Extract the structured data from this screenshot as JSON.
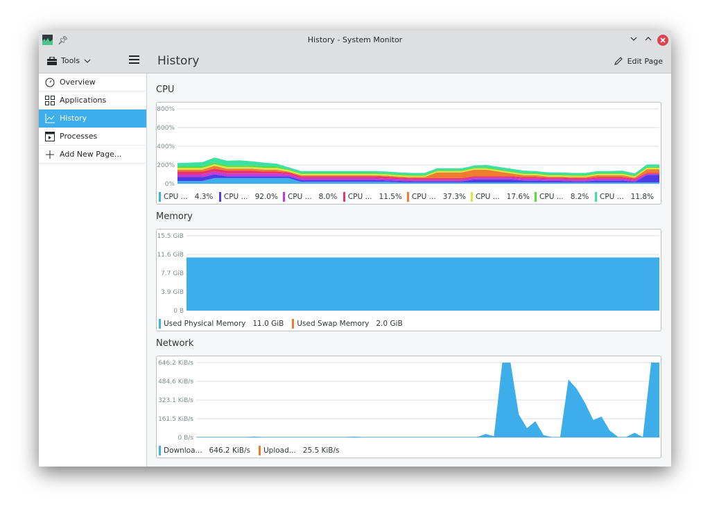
{
  "window": {
    "title": "History - System Monitor",
    "buttons": {
      "minimize": "﹀",
      "maximize": "︿",
      "close": "✕"
    }
  },
  "header": {
    "tools_label": "Tools",
    "page_title": "History",
    "edit_page_label": "Edit Page"
  },
  "sidebar": {
    "items": [
      {
        "label": "Overview",
        "icon": "gauge-icon",
        "active": false
      },
      {
        "label": "Applications",
        "icon": "grid-icon",
        "active": false
      },
      {
        "label": "History",
        "icon": "chart-line-icon",
        "active": true
      },
      {
        "label": "Processes",
        "icon": "terminal-window-icon",
        "active": false
      },
      {
        "label": "Add New Page...",
        "icon": "plus-icon",
        "active": false
      }
    ]
  },
  "colors": {
    "accent": "#3daee9",
    "close": "#da4453"
  },
  "sections": {
    "cpu": {
      "title": "CPU"
    },
    "memory": {
      "title": "Memory"
    },
    "network": {
      "title": "Network"
    }
  },
  "chart_data": [
    {
      "type": "area",
      "title": "CPU",
      "stacked": true,
      "y_ticks": [
        "800%",
        "600%",
        "400%",
        "200%",
        "0%"
      ],
      "ylim": [
        0,
        800
      ],
      "grid": true,
      "legend_placement": "bottom",
      "x_points": 40,
      "series": [
        {
          "name": "CPU ...",
          "value_label": "4.3%",
          "color": "#3daee9",
          "values": [
            30,
            30,
            30,
            60,
            60,
            60,
            60,
            60,
            60,
            60,
            20,
            20,
            20,
            20,
            20,
            20,
            20,
            20,
            15,
            15,
            15,
            15,
            15,
            15,
            15,
            15,
            15,
            15,
            15,
            15,
            15,
            15,
            15,
            15,
            15,
            15,
            15,
            15,
            15,
            15
          ]
        },
        {
          "name": "CPU ...",
          "value_label": "92.0%",
          "color": "#4f3ce6",
          "values": [
            40,
            40,
            40,
            40,
            20,
            20,
            20,
            20,
            20,
            20,
            20,
            20,
            20,
            20,
            20,
            20,
            20,
            15,
            15,
            10,
            10,
            10,
            10,
            10,
            30,
            30,
            30,
            30,
            20,
            20,
            15,
            15,
            10,
            10,
            20,
            20,
            20,
            5,
            80,
            80
          ]
        },
        {
          "name": "CPU ...",
          "value_label": "8.0%",
          "color": "#c13cd6",
          "values": [
            30,
            30,
            30,
            30,
            30,
            30,
            30,
            30,
            30,
            20,
            20,
            20,
            20,
            20,
            20,
            20,
            20,
            20,
            20,
            20,
            20,
            20,
            20,
            20,
            20,
            20,
            20,
            20,
            20,
            20,
            20,
            20,
            20,
            20,
            20,
            20,
            20,
            20,
            10,
            10
          ]
        },
        {
          "name": "CPU ...",
          "value_label": "11.5%",
          "color": "#e8346b",
          "values": [
            30,
            30,
            30,
            30,
            30,
            30,
            30,
            20,
            20,
            20,
            20,
            20,
            20,
            20,
            20,
            20,
            20,
            20,
            15,
            15,
            15,
            15,
            15,
            15,
            15,
            15,
            15,
            15,
            15,
            15,
            15,
            15,
            15,
            15,
            15,
            15,
            15,
            15,
            10,
            10
          ]
        },
        {
          "name": "CPU ...",
          "value_label": "37.3%",
          "color": "#f07c2f",
          "values": [
            20,
            20,
            20,
            30,
            20,
            20,
            20,
            20,
            20,
            10,
            10,
            10,
            10,
            10,
            10,
            10,
            10,
            10,
            10,
            10,
            10,
            60,
            60,
            60,
            70,
            70,
            50,
            30,
            20,
            20,
            10,
            10,
            10,
            10,
            20,
            20,
            20,
            10,
            40,
            40
          ]
        },
        {
          "name": "CPU ...",
          "value_label": "17.6%",
          "color": "#d4e84a",
          "values": [
            20,
            20,
            20,
            20,
            20,
            20,
            20,
            20,
            20,
            15,
            15,
            15,
            15,
            15,
            15,
            15,
            15,
            15,
            15,
            15,
            15,
            15,
            15,
            15,
            15,
            15,
            15,
            15,
            15,
            15,
            15,
            15,
            15,
            15,
            15,
            15,
            15,
            15,
            15,
            15
          ]
        },
        {
          "name": "CPU ...",
          "value_label": "8.2%",
          "color": "#5ad83c",
          "values": [
            15,
            15,
            15,
            15,
            15,
            15,
            15,
            15,
            15,
            10,
            10,
            10,
            10,
            10,
            10,
            10,
            10,
            10,
            10,
            10,
            10,
            10,
            10,
            10,
            10,
            10,
            10,
            10,
            10,
            10,
            10,
            10,
            10,
            10,
            10,
            10,
            10,
            10,
            10,
            10
          ]
        },
        {
          "name": "CPU ...",
          "value_label": "11.8%",
          "color": "#3ce0a0",
          "values": [
            35,
            40,
            45,
            55,
            50,
            55,
            45,
            40,
            30,
            20,
            20,
            20,
            20,
            20,
            20,
            20,
            20,
            20,
            20,
            20,
            20,
            20,
            20,
            20,
            20,
            25,
            25,
            25,
            25,
            20,
            20,
            20,
            20,
            20,
            20,
            20,
            25,
            20,
            25,
            25
          ]
        }
      ]
    },
    {
      "type": "area",
      "title": "Memory",
      "stacked": true,
      "y_ticks": [
        "15.5 GiB",
        "11.6 GiB",
        "7.7 GiB",
        "3.9 GiB",
        "0 B"
      ],
      "ylim": [
        0,
        15.5
      ],
      "grid": true,
      "legend_placement": "bottom",
      "series": [
        {
          "name": "Used Physical Memory",
          "value_label": "11.0 GiB",
          "color": "#3daee9",
          "values": [
            11.0,
            11.0
          ]
        },
        {
          "name": "Used Swap Memory",
          "value_label": "2.0 GiB",
          "color": "#f07c2f",
          "values": []
        }
      ]
    },
    {
      "type": "area",
      "title": "Network",
      "stacked": false,
      "y_ticks": [
        "646.2 KiB/s",
        "484.6 KiB/s",
        "323.1 KiB/s",
        "161.5 KiB/s",
        "0 B/s"
      ],
      "ylim": [
        0,
        646.2
      ],
      "grid": true,
      "legend_placement": "bottom",
      "series": [
        {
          "name": "Downloa...",
          "value_label": "646.2 KiB/s",
          "color": "#3daee9",
          "values": [
            5,
            5,
            5,
            5,
            5,
            5,
            5,
            8,
            5,
            5,
            5,
            5,
            5,
            5,
            5,
            5,
            5,
            5,
            5,
            8,
            5,
            5,
            5,
            5,
            5,
            5,
            5,
            5,
            5,
            5,
            5,
            5,
            5,
            5,
            5,
            30,
            10,
            646,
            646,
            200,
            80,
            140,
            20,
            5,
            5,
            500,
            420,
            300,
            150,
            180,
            60,
            5,
            5,
            40,
            5,
            646,
            646
          ]
        },
        {
          "name": "Upload...",
          "value_label": "25.5 KiB/s",
          "color": "#f07c2f",
          "values": []
        }
      ]
    }
  ]
}
